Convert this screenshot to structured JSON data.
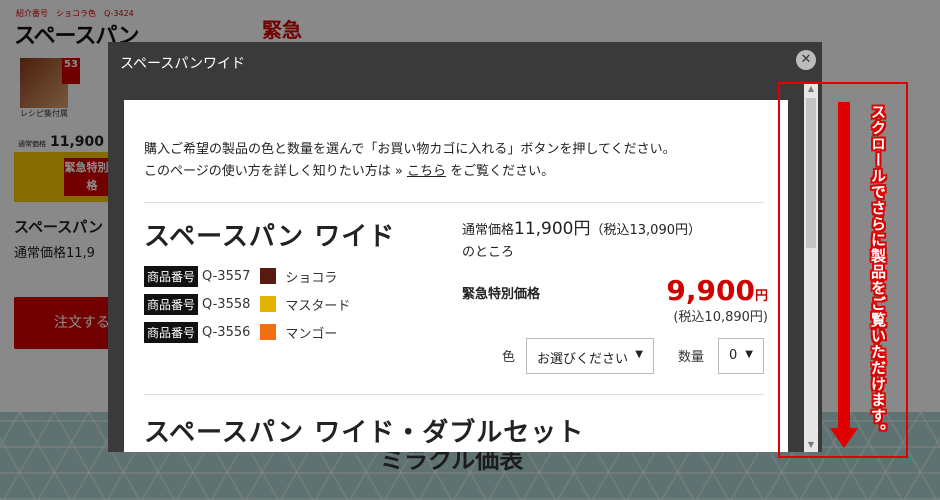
{
  "background": {
    "logo_small": "紹介番号　ショコラ色　Q-3424",
    "logo": "スペースパン",
    "urgent": "緊急",
    "badge": "53",
    "recipe": "レシピ集付属",
    "price_label": "通常価格",
    "price_old": "11,900",
    "urgent_box": "緊急特別価格",
    "name": "スペースパン",
    "price_line": "通常価格11,9",
    "order_button": "注文する",
    "section_title": "ミラクル価表"
  },
  "modal": {
    "title": "スペースパンワイド",
    "close_icon": "✕",
    "intro_line1": "購入ご希望の製品の色と数量を選んで「お買い物カゴに入れる」ボタンを押してください。",
    "intro_line2_pre": "このページの使い方を詳しく知りたい方は »",
    "intro_link": "こちら",
    "intro_line2_post": "をご覧ください。",
    "product": {
      "name": "スペースパン ワイド",
      "variants": [
        {
          "tag": "商品番号",
          "code": "Q-3557",
          "color": "#5a1a12",
          "label": "ショコラ"
        },
        {
          "tag": "商品番号",
          "code": "Q-3558",
          "color": "#e0b400",
          "label": "マスタード"
        },
        {
          "tag": "商品番号",
          "code": "Q-3556",
          "color": "#f07010",
          "label": "マンゴー"
        }
      ],
      "regular_label": "通常価格",
      "regular_price": "11,900円",
      "regular_tax": "（税込13,090円）",
      "regular_suffix": "のところ",
      "special_label": "緊急特別価格",
      "special_price": "9,900",
      "special_unit": "円",
      "special_tax": "(税込10,890円)",
      "color_label": "色",
      "color_select": "お選びください",
      "qty_label": "数量",
      "qty_select": "0"
    },
    "product2_name": "スペースパン ワイド・ダブルセット"
  },
  "annotation": {
    "text": "スクロールでさらに製品をご覧いただけます。",
    "color": "#e00000"
  }
}
